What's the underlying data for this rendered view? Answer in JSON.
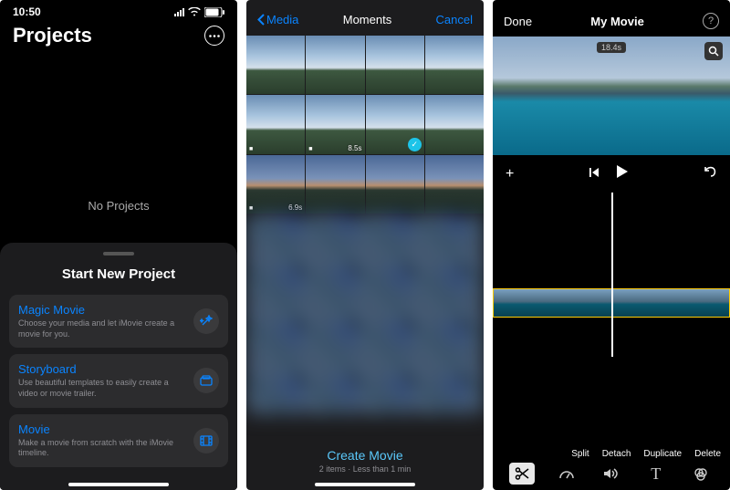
{
  "screen1": {
    "status_time": "10:50",
    "title": "Projects",
    "empty_text": "No Projects",
    "panel_title": "Start New Project",
    "options": [
      {
        "title": "Magic Movie",
        "sub": "Choose your media and let iMovie create a movie for you.",
        "icon": "wand"
      },
      {
        "title": "Storyboard",
        "sub": "Use beautiful templates to easily create a video or movie trailer.",
        "icon": "storyboard"
      },
      {
        "title": "Movie",
        "sub": "Make a movie from scratch with the iMovie timeline.",
        "icon": "film"
      }
    ]
  },
  "screen2": {
    "back_label": "Media",
    "title": "Moments",
    "cancel": "Cancel",
    "thumbs": [
      {
        "dur": "",
        "vid": false
      },
      {
        "dur": "",
        "vid": false
      },
      {
        "dur": "",
        "vid": false
      },
      {
        "dur": "",
        "vid": false
      },
      {
        "dur": "",
        "vid": true
      },
      {
        "dur": "8.5s",
        "vid": true
      },
      {
        "dur": "",
        "vid": false,
        "selected": true
      },
      {
        "dur": "",
        "vid": false
      },
      {
        "dur": "6.9s",
        "vid": true,
        "style": "sunset"
      },
      {
        "dur": "",
        "vid": false,
        "style": "sunset"
      },
      {
        "dur": "",
        "vid": false,
        "style": "sunset"
      },
      {
        "dur": "",
        "vid": false,
        "style": "sunset"
      }
    ],
    "create_label": "Create Movie",
    "create_sub": "2 items · Less than 1 min"
  },
  "screen3": {
    "done": "Done",
    "title": "My Movie",
    "time_badge": "18.4s",
    "edit_actions": [
      "Split",
      "Detach",
      "Duplicate",
      "Delete"
    ],
    "tools": [
      "scissors",
      "speed",
      "volume",
      "text",
      "filter"
    ]
  }
}
